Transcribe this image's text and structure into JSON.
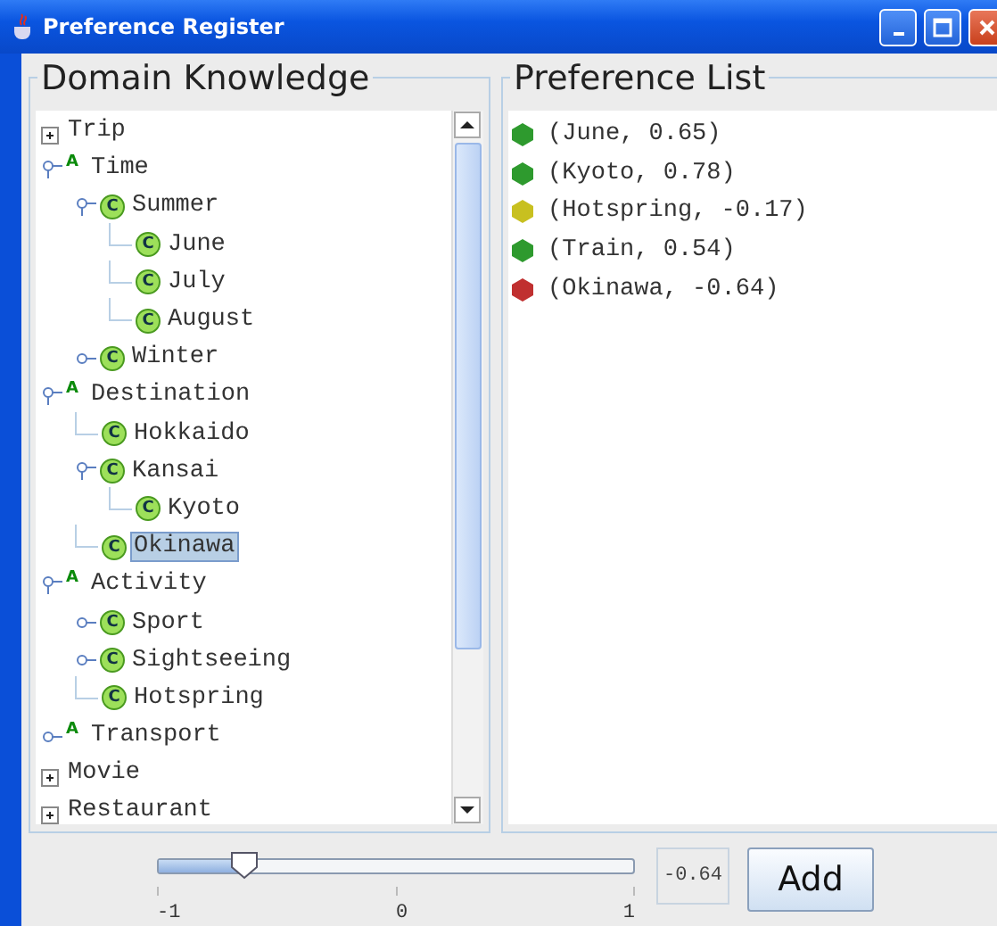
{
  "window": {
    "title": "Preference Register"
  },
  "domain_knowledge": {
    "title": "Domain Knowledge",
    "tree": [
      {
        "label": "Trip",
        "kind": "group",
        "expanded": false,
        "selected": false
      },
      {
        "label": "Time",
        "kind": "attribute",
        "badge": "A",
        "expanded": true,
        "selected": false,
        "children": [
          {
            "label": "Summer",
            "kind": "class",
            "badge": "C",
            "expanded": true,
            "selected": false,
            "children": [
              {
                "label": "June",
                "kind": "class",
                "badge": "C",
                "selected": false
              },
              {
                "label": "July",
                "kind": "class",
                "badge": "C",
                "selected": false
              },
              {
                "label": "August",
                "kind": "class",
                "badge": "C",
                "selected": false
              }
            ]
          },
          {
            "label": "Winter",
            "kind": "class",
            "badge": "C",
            "expanded": false,
            "selected": false
          }
        ]
      },
      {
        "label": "Destination",
        "kind": "attribute",
        "badge": "A",
        "expanded": true,
        "selected": false,
        "children": [
          {
            "label": "Hokkaido",
            "kind": "class",
            "badge": "C",
            "selected": false
          },
          {
            "label": "Kansai",
            "kind": "class",
            "badge": "C",
            "expanded": true,
            "selected": false,
            "children": [
              {
                "label": "Kyoto",
                "kind": "class",
                "badge": "C",
                "selected": false
              }
            ]
          },
          {
            "label": "Okinawa",
            "kind": "class",
            "badge": "C",
            "selected": true
          }
        ]
      },
      {
        "label": "Activity",
        "kind": "attribute",
        "badge": "A",
        "expanded": true,
        "selected": false,
        "children": [
          {
            "label": "Sport",
            "kind": "class",
            "badge": "C",
            "expanded": false,
            "selected": false
          },
          {
            "label": "Sightseeing",
            "kind": "class",
            "badge": "C",
            "expanded": false,
            "selected": false
          },
          {
            "label": "Hotspring",
            "kind": "class",
            "badge": "C",
            "selected": false
          }
        ]
      },
      {
        "label": "Transport",
        "kind": "attribute",
        "badge": "A",
        "expanded": false,
        "selected": false
      },
      {
        "label": "Movie",
        "kind": "group",
        "expanded": false,
        "selected": false
      },
      {
        "label": "Restaurant",
        "kind": "group",
        "expanded": false,
        "selected": false
      }
    ]
  },
  "preference_list": {
    "title": "Preference List",
    "items": [
      {
        "text": "(June, 0.65)",
        "color": "#2e9a2e"
      },
      {
        "text": "(Kyoto, 0.78)",
        "color": "#2e9a2e"
      },
      {
        "text": "(Hotspring, -0.17)",
        "color": "#c8c020"
      },
      {
        "text": "(Train, 0.54)",
        "color": "#2e9a2e"
      },
      {
        "text": "(Okinawa, -0.64)",
        "color": "#c03030"
      }
    ]
  },
  "controls": {
    "slider": {
      "level": 0.18,
      "tick_labels": [
        "-1",
        "0",
        "1"
      ]
    },
    "value": "-0.64",
    "button": "Add"
  }
}
